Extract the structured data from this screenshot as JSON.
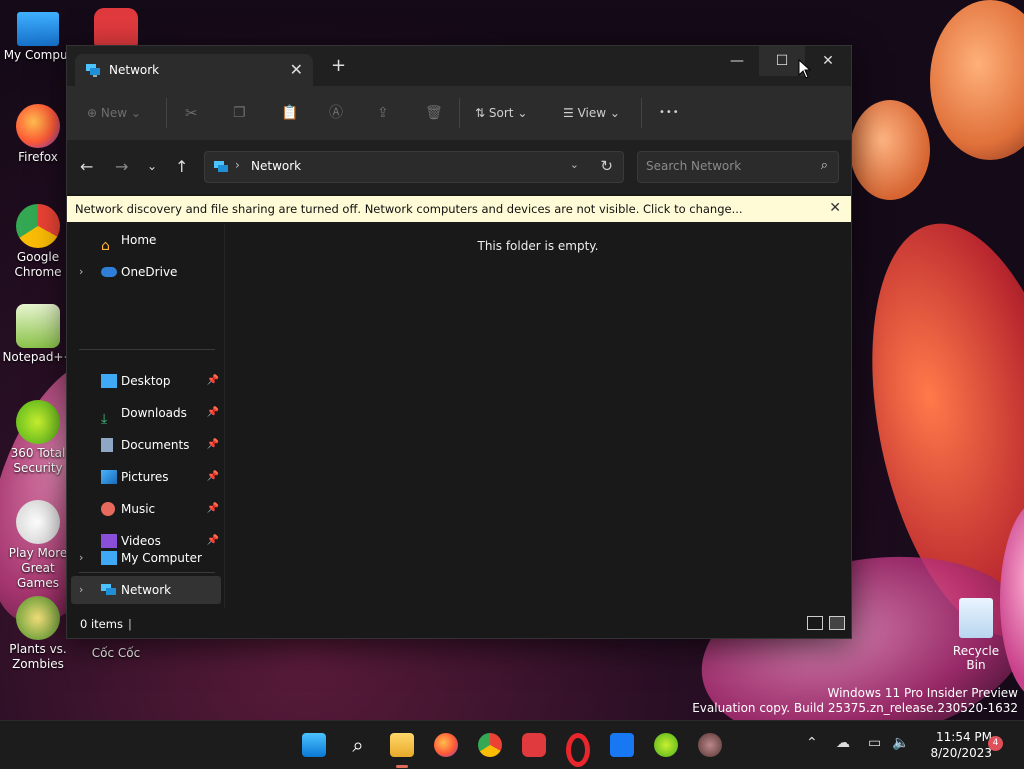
{
  "desktop": {
    "icons": [
      {
        "label": "My Comput"
      },
      {
        "label": "Firefox"
      },
      {
        "label": "Google Chrome"
      },
      {
        "label": "Notepad++"
      },
      {
        "label": "360 Total Security"
      },
      {
        "label": "Play More Great Games"
      },
      {
        "label": "Plants vs. Zombies"
      },
      {
        "label": "Cốc Cốc"
      },
      {
        "label": "Recycle Bin"
      }
    ],
    "watermark": {
      "line1": "Windows 11 Pro Insider Preview",
      "line2": "Evaluation copy. Build 25375.zn_release.230520-1632"
    }
  },
  "window": {
    "tab": {
      "title": "Network",
      "close": "✕"
    },
    "new_tab": "+",
    "controls": {
      "minimize": "—",
      "maximize": "☐",
      "close": "✕"
    },
    "command_bar": {
      "new_label": "New",
      "sort_label": "Sort",
      "view_label": "View",
      "more": "•••"
    },
    "address": {
      "path": "Network",
      "separator": "›"
    },
    "search": {
      "placeholder": "Search Network"
    },
    "infobar": {
      "message": "Network discovery and file sharing are turned off. Network computers and devices are not visible. Click to change...",
      "close": "✕"
    },
    "nav": {
      "home": "Home",
      "onedrive": "OneDrive",
      "quick": [
        {
          "label": "Desktop"
        },
        {
          "label": "Downloads"
        },
        {
          "label": "Documents"
        },
        {
          "label": "Pictures"
        },
        {
          "label": "Music"
        },
        {
          "label": "Videos"
        }
      ],
      "my_computer": "My Computer",
      "network": "Network"
    },
    "content": {
      "empty_message": "This folder is empty."
    },
    "status": {
      "count": "0 items"
    }
  },
  "taskbar": {
    "clock": {
      "time": "11:54 PM",
      "date": "8/20/2023"
    },
    "notification_count": "4"
  },
  "colors": {
    "accent": "#4cc2ff",
    "infobar": "#fffbd6",
    "window_bg": "#191919"
  }
}
